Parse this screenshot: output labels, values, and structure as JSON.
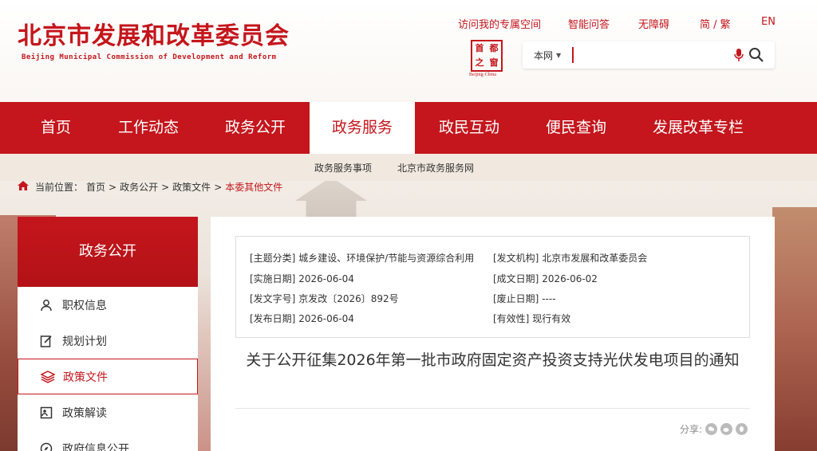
{
  "header": {
    "title_cn": "北京市发展和改革委员会",
    "title_en": "Beijing Municipal Commission of Development and Reform",
    "top_links": [
      "访问我的专属空间",
      "智能问答",
      "无障碍",
      "简 / 繁",
      "EN"
    ],
    "seal_chars": [
      "首",
      "都",
      "之",
      "窗"
    ],
    "seal_caption": "Beijing·China",
    "search": {
      "scope": "本网",
      "placeholder": "",
      "value": ""
    }
  },
  "nav": {
    "items": [
      "首页",
      "工作动态",
      "政务公开",
      "政务服务",
      "政民互动",
      "便民查询",
      "发展改革专栏"
    ],
    "active_index": 3
  },
  "subnav": {
    "items": [
      "政务服务事项",
      "北京市政务服务网"
    ]
  },
  "breadcrumb": {
    "label": "当前位置：",
    "items": [
      "首页",
      "政务公开",
      "政策文件"
    ],
    "current": "本委其他文件",
    "separator": ">"
  },
  "sidebar": {
    "title": "政务公开",
    "items": [
      {
        "label": "职权信息",
        "icon": "person-icon"
      },
      {
        "label": "规划计划",
        "icon": "edit-document-icon"
      },
      {
        "label": "政策文件",
        "icon": "layers-icon"
      },
      {
        "label": "政策解读",
        "icon": "interpretation-icon"
      },
      {
        "label": "政府信息公开",
        "icon": "compass-icon"
      }
    ],
    "active_index": 2
  },
  "document": {
    "meta": {
      "topic_key": "[主题分类]",
      "topic": "城乡建设、环境保护/节能与资源综合利用",
      "issuer_key": "[发文机构]",
      "issuer": "北京市发展和改革委员会",
      "effective_key": "[实施日期]",
      "effective": "2026-06-04",
      "written_key": "[成文日期]",
      "written": "2026-06-02",
      "docno_key": "[发文字号]",
      "docno": "京发改〔2026〕892号",
      "abolish_key": "[废止日期]",
      "abolish": "----",
      "publish_key": "[发布日期]",
      "publish": "2026-06-04",
      "validity_key": "[有效性]",
      "validity": "现行有效"
    },
    "title": "关于公开征集2026年第一批市政府固定资产投资支持光伏发电项目的通知",
    "share_label": "分享:"
  },
  "colors": {
    "brand": "#c4161c",
    "page_bg": "#f4efe9"
  }
}
